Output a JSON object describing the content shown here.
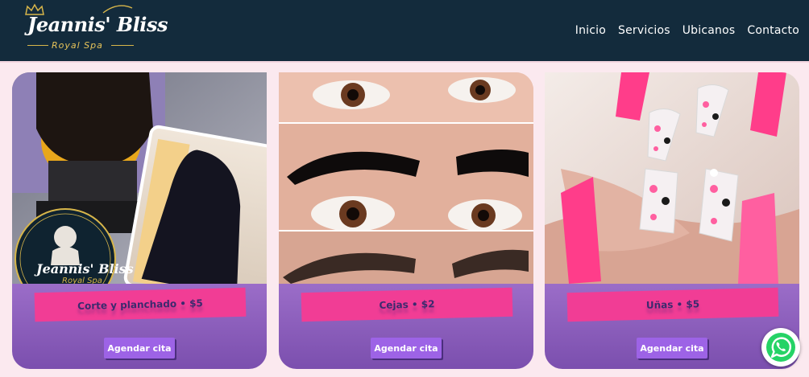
{
  "header": {
    "logo": {
      "name": "Jeannis' Bliss",
      "tagline": "Royal Spa"
    },
    "nav": [
      {
        "label": "Inicio"
      },
      {
        "label": "Servicios"
      },
      {
        "label": "Ubicanos"
      },
      {
        "label": "Contacto"
      }
    ]
  },
  "services": [
    {
      "title": "Corte y planchado • $5",
      "button": "Agendar cita",
      "image": "hair-photo",
      "badge": {
        "name": "Jeannis' Bliss",
        "tagline": "Royal Spa"
      }
    },
    {
      "title": "Cejas • $2",
      "button": "Agendar cita",
      "image": "eyebrows-photo"
    },
    {
      "title": "Uñas • $5",
      "button": "Agendar cita",
      "image": "nails-photo"
    }
  ],
  "colors": {
    "header_bg": "#132b3c",
    "page_bg": "#fbe9ef",
    "accent_pink": "#f13d95",
    "card_purple": "#8a5cbb",
    "button_purple": "#9d63e6",
    "logo_gold": "#d8b64a"
  },
  "icons": {
    "floating": "whatsapp-icon"
  }
}
